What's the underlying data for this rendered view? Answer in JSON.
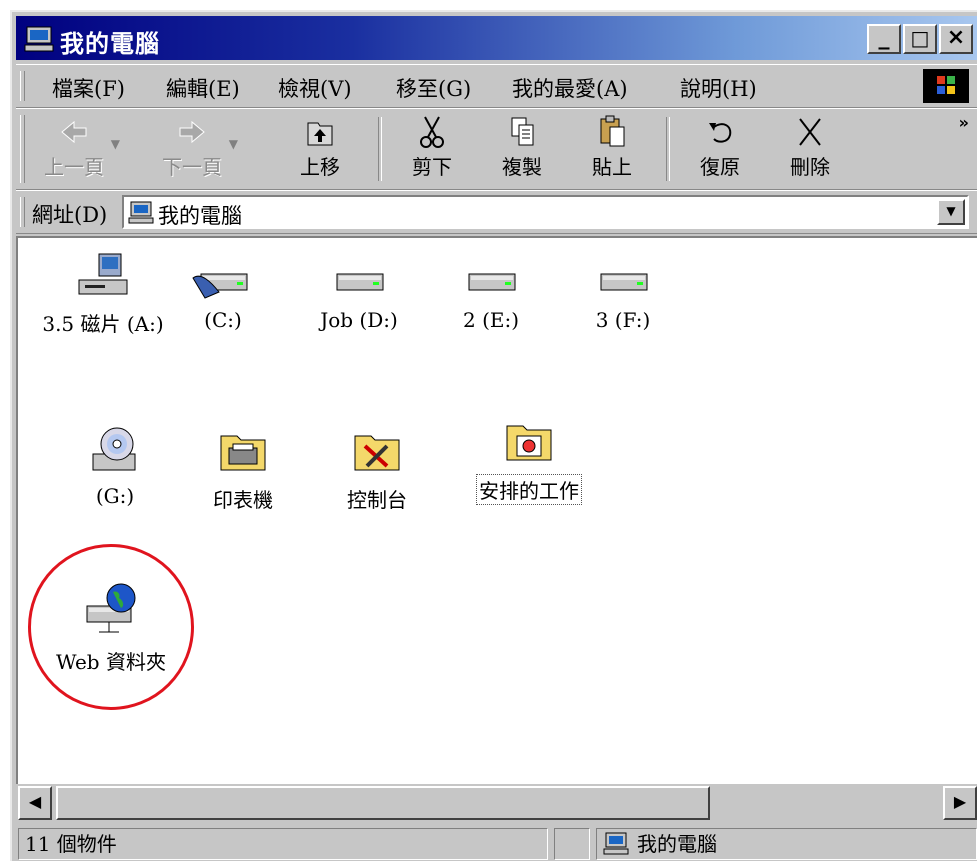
{
  "window": {
    "title": "我的電腦",
    "min_label": "_",
    "max_label": "□",
    "close_label": "×"
  },
  "menu": {
    "items": [
      "檔案(F)",
      "編輯(E)",
      "檢視(V)",
      "移至(G)",
      "我的最愛(A)",
      "說明(H)"
    ]
  },
  "toolbar": {
    "buttons": [
      {
        "label": "上一頁",
        "icon": "back-arrow-icon",
        "enabled": false
      },
      {
        "label": "下一頁",
        "icon": "forward-arrow-icon",
        "enabled": false
      },
      {
        "label": "上移",
        "icon": "up-folder-icon",
        "enabled": true
      },
      {
        "label": "剪下",
        "icon": "scissors-icon",
        "enabled": true
      },
      {
        "label": "複製",
        "icon": "copy-icon",
        "enabled": true
      },
      {
        "label": "貼上",
        "icon": "paste-icon",
        "enabled": true
      },
      {
        "label": "復原",
        "icon": "undo-icon",
        "enabled": true
      },
      {
        "label": "刪除",
        "icon": "delete-x-icon",
        "enabled": true
      }
    ],
    "more": "»"
  },
  "address": {
    "label": "網址(D)",
    "value": "我的電腦",
    "dropdown": "▼"
  },
  "items": [
    {
      "label": "3.5 磁片 (A:)",
      "icon": "floppy-drive-icon"
    },
    {
      "label": "(C:)",
      "icon": "hard-disk-icon"
    },
    {
      "label": "Job (D:)",
      "icon": "drive-icon"
    },
    {
      "label": "2 (E:)",
      "icon": "drive-icon"
    },
    {
      "label": "3 (F:)",
      "icon": "drive-icon"
    },
    {
      "label": "(G:)",
      "icon": "cd-drive-icon"
    },
    {
      "label": "印表機",
      "icon": "printers-folder-icon"
    },
    {
      "label": "控制台",
      "icon": "control-panel-folder-icon"
    },
    {
      "label": "安排的工作",
      "icon": "scheduled-tasks-folder-icon"
    },
    {
      "label": "Web 資料夾",
      "icon": "web-folders-icon"
    }
  ],
  "scroll": {
    "left": "◀",
    "right": "▶"
  },
  "status": {
    "count": "11 個物件",
    "location": "我的電腦"
  },
  "colors": {
    "titlebar_start": "#000080",
    "titlebar_end": "#a8c7ef",
    "highlight_circle": "#e0141e",
    "face": "#c6c6c6"
  }
}
